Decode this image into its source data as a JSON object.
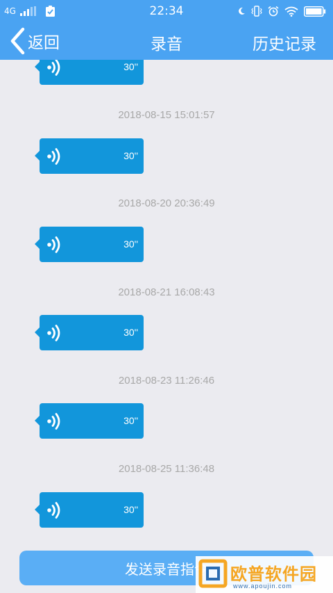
{
  "status_bar": {
    "network": "4G",
    "time": "22:34"
  },
  "nav": {
    "back_label": "返回",
    "title": "录音",
    "history_label": "历史记录"
  },
  "recordings": [
    {
      "timestamp": "",
      "duration": "30''"
    },
    {
      "timestamp": "2018-08-15 15:01:57",
      "duration": "30''"
    },
    {
      "timestamp": "2018-08-20 20:36:49",
      "duration": "30''"
    },
    {
      "timestamp": "2018-08-21 16:08:43",
      "duration": "30''"
    },
    {
      "timestamp": "2018-08-23 11:26:46",
      "duration": "30''"
    },
    {
      "timestamp": "2018-08-25 11:36:48",
      "duration": "30''"
    }
  ],
  "send_button": {
    "label": "发送录音指令"
  },
  "watermark": {
    "text": "欧普软件园",
    "url": "www.apoujin.com"
  },
  "colors": {
    "nav_bg": "#4aa3f2",
    "bubble": "#1296db",
    "page_bg": "#ebebf0",
    "button": "#5aaef5",
    "timestamp_text": "#a8a8a8"
  }
}
